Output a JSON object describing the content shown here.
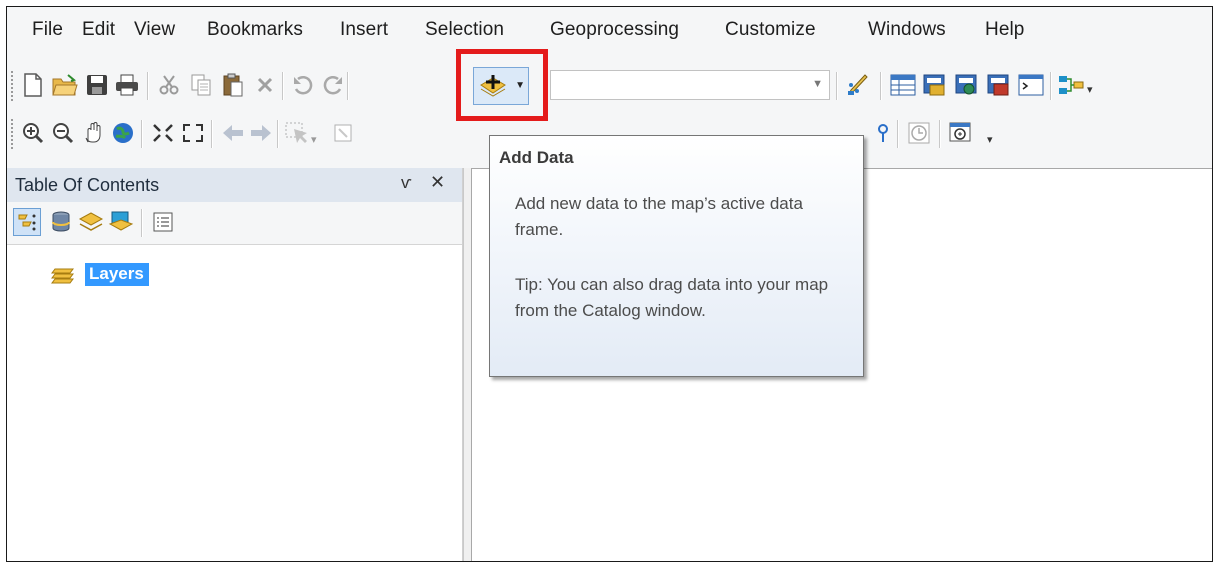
{
  "menu": {
    "file": "File",
    "edit": "Edit",
    "view": "View",
    "bookmarks": "Bookmarks",
    "insert": "Insert",
    "selection": "Selection",
    "geoprocessing": "Geoprocessing",
    "customize": "Customize",
    "windows": "Windows",
    "help": "Help"
  },
  "standard_toolbar": {
    "icons": [
      "new-document-icon",
      "open-folder-icon",
      "save-icon",
      "print-icon",
      "cut-icon",
      "copy-icon",
      "paste-icon",
      "delete-icon",
      "undo-icon",
      "redo-icon",
      "add-data-icon",
      "scale-combo",
      "editor-toolbar-icon",
      "table-icon",
      "arccatalog-icon",
      "search-icon",
      "arctoolbox-icon",
      "python-icon",
      "model-builder-icon"
    ],
    "scale_value": ""
  },
  "tools_toolbar": {
    "icons": [
      "zoom-in-icon",
      "zoom-out-icon",
      "pan-icon",
      "full-extent-icon",
      "fixed-zoom-in-icon",
      "fixed-zoom-out-icon",
      "back-extent-icon",
      "forward-extent-icon",
      "select-features-icon",
      "clear-selection-icon",
      "select-elements-icon",
      "identify-icon",
      "find-icon",
      "measure-icon",
      "go-to-xy-icon",
      "time-slider-icon",
      "magnifier-icon"
    ]
  },
  "toc": {
    "title": "Table Of Contents",
    "pin": "ѵ",
    "close": "✕",
    "root_layer": "Layers"
  },
  "tooltip": {
    "title": "Add Data",
    "description": "Add new data to the map’s active data frame.",
    "tip": "Tip: You can also drag data into your map from the Catalog window."
  },
  "colors": {
    "highlight": "#e41b1b",
    "selection": "#3399ff",
    "panel_header": "#dfe6ef"
  }
}
